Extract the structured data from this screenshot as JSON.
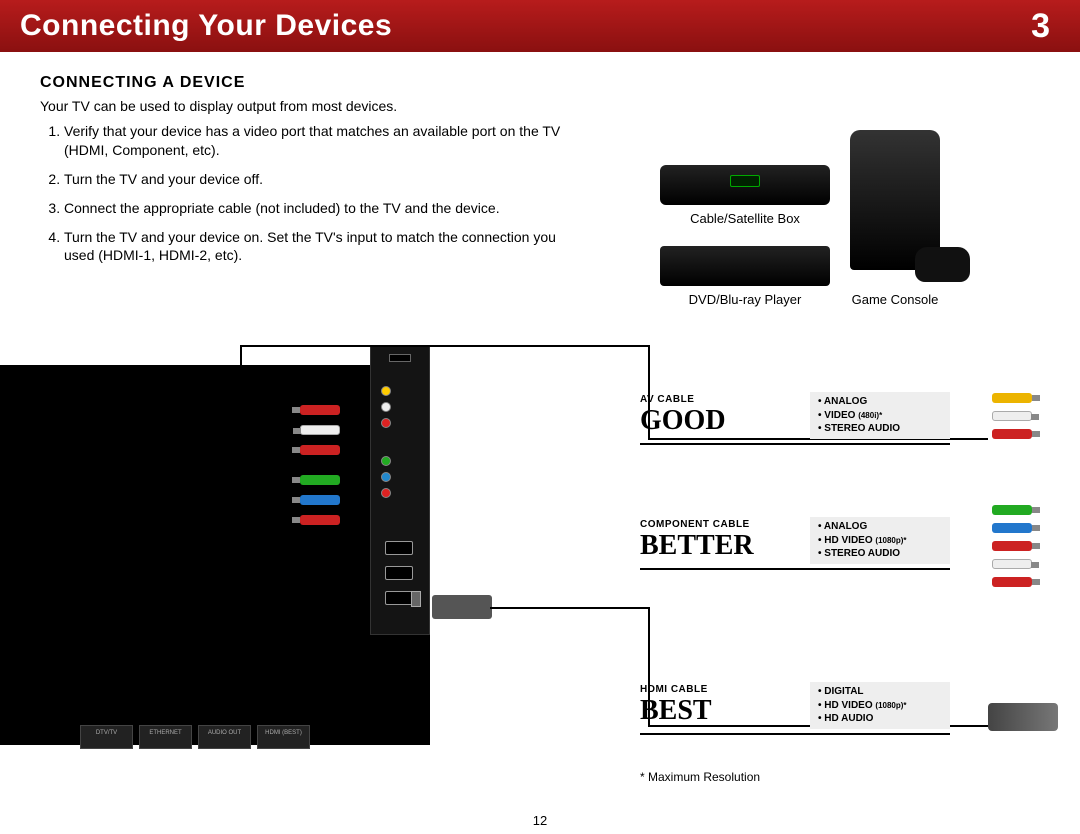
{
  "header": {
    "title": "Connecting Your Devices",
    "chapter": "3"
  },
  "section": {
    "title": "CONNECTING A DEVICE",
    "intro": "Your TV can be used to display output from most devices.",
    "steps": [
      "Verify that your device has a video port that matches an available port on the TV (HDMI, Component, etc).",
      "Turn the TV and your device off.",
      "Connect the appropriate cable (not included) to the TV and the device.",
      "Turn the TV and your device on. Set the TV's input to match the connection you used (HDMI-1, HDMI-2, etc)."
    ]
  },
  "devices": {
    "cable": "Cable/Satellite Box",
    "dvd": "DVD/Blu-ray Player",
    "console": "Game Console"
  },
  "quality": {
    "good": {
      "cable": "AV CABLE",
      "rating": "GOOD",
      "spec1": "• ANALOG",
      "spec2_a": "• VIDEO ",
      "spec2_b": "(480i)*",
      "spec3": "• STEREO AUDIO"
    },
    "better": {
      "cable": "COMPONENT CABLE",
      "rating": "BETTER",
      "spec1": "• ANALOG",
      "spec2_a": "• HD VIDEO ",
      "spec2_b": "(1080p)*",
      "spec3": "• STEREO AUDIO"
    },
    "best": {
      "cable": "HDMI CABLE",
      "rating": "BEST",
      "spec1": "• DIGITAL",
      "spec2_a": "• HD VIDEO ",
      "spec2_b": "(1080p)*",
      "spec3": "• HD AUDIO"
    }
  },
  "ports": {
    "dtv": "DTV/TV",
    "eth": "ETHERNET",
    "audio": "AUDIO OUT",
    "hdmi": "HDMI (BEST)"
  },
  "footnote": "*  Maximum Resolution",
  "page": "12"
}
